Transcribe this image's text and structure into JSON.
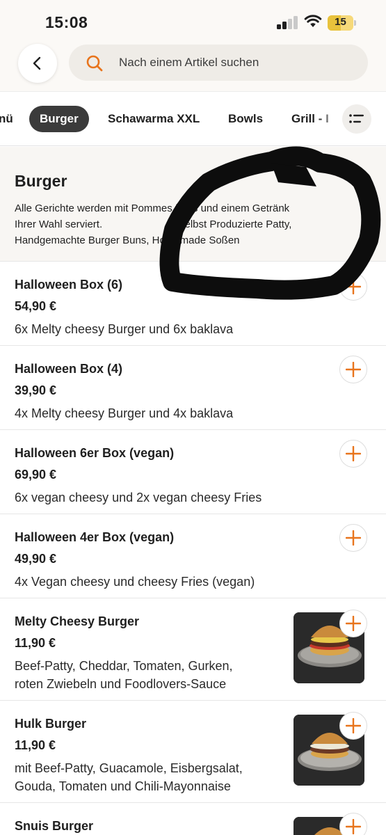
{
  "status_bar": {
    "time": "15:08",
    "battery": "15"
  },
  "header": {
    "search_placeholder": "Nach einem Artikel suchen"
  },
  "tabs": [
    {
      "label": "nü"
    },
    {
      "label": "Burger"
    },
    {
      "label": "Schawarma XXL"
    },
    {
      "label": "Bowls"
    },
    {
      "label": "Grill - I"
    }
  ],
  "section": {
    "title": "Burger",
    "description_lines": [
      "Alle Gerichte werden mit Pommes frites und einem Getränk",
      "Ihrer Wahl serviert.                          Selbst Produzierte Patty,",
      "Handgemachte Burger Buns, Homemade Soßen"
    ]
  },
  "items": [
    {
      "name": "Halloween Box (6)",
      "price": "54,90 €",
      "desc": [
        "6x Melty cheesy Burger und 6x baklava"
      ]
    },
    {
      "name": "Halloween Box (4)",
      "price": "39,90 €",
      "desc": [
        "4x Melty cheesy Burger und 4x baklava"
      ]
    },
    {
      "name": "Halloween 6er Box (vegan)",
      "price": "69,90 €",
      "desc": [
        "6x vegan cheesy und 2x vegan cheesy Fries"
      ]
    },
    {
      "name": "Halloween 4er Box (vegan)",
      "price": "49,90 €",
      "desc": [
        "4x Vegan cheesy und cheesy Fries (vegan)"
      ]
    },
    {
      "name": "Melty Cheesy Burger",
      "price": "11,90 €",
      "desc": [
        "Beef-Patty, Cheddar, Tomaten, Gurken,",
        "roten Zwiebeln und Foodlovers-Sauce"
      ]
    },
    {
      "name": "Hulk Burger",
      "price": "11,90 €",
      "desc": [
        "mit Beef-Patty, Guacamole, Eisbergsalat,",
        "Gouda, Tomaten und Chili-Mayonnaise"
      ]
    },
    {
      "name": "Snuis Burger",
      "price": "",
      "desc": []
    }
  ],
  "colors": {
    "accent": "#e8741c",
    "active_tab": "#3b3b3b",
    "background": "#fbf9f6"
  }
}
